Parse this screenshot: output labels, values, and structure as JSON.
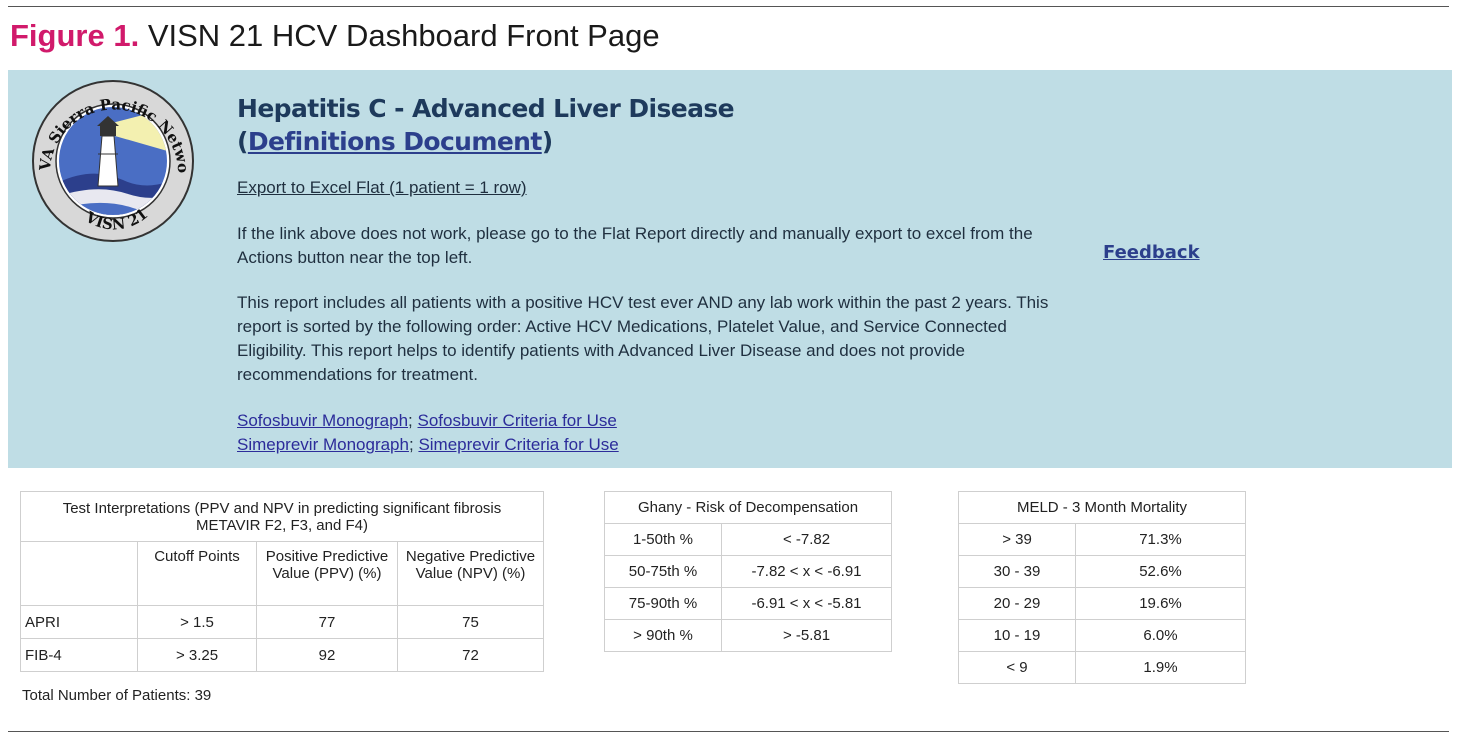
{
  "figure": {
    "number": "Figure 1.",
    "title": "VISN 21 HCV Dashboard Front Page"
  },
  "logo": {
    "arc_text": "VA Sierra Pacific Network",
    "bottom_text": "VISN 21"
  },
  "header": {
    "title_line1": "Hepatitis C - Advanced Liver Disease",
    "paren_open": "(",
    "definitions_link": "Definitions Document",
    "paren_close": ")"
  },
  "export_link": "Export to Excel Flat (1 patient = 1 row)",
  "note_link_fail": "If the link above does not work, please go to the Flat Report directly and manually export to excel from the Actions button near the top left.",
  "note_report": "This report includes all patients with a positive HCV test ever AND any lab work within the past 2 years. This report is sorted by the following order: Active HCV Medications, Platelet Value, and Service Connected Eligibility. This report helps to identify patients with Advanced Liver Disease and does not provide recommendations for treatment.",
  "feedback": "Feedback",
  "monograph_links": {
    "sofosbuvir_monograph": "Sofosbuvir Monograph",
    "sofosbuvir_criteria": "Sofosbuvir Criteria for Use",
    "simeprevir_monograph": "Simeprevir Monograph",
    "simeprevir_criteria": "Simeprevir Criteria for Use",
    "separator": ";"
  },
  "test_table": {
    "title": "Test Interpretations (PPV and NPV in predicting significant fibrosis METAVIR F2, F3, and F4)",
    "headers": [
      "",
      "Cutoff Points",
      "Positive Predictive Value (PPV) (%)",
      "Negative Predictive Value (NPV) (%)"
    ],
    "rows": [
      [
        "APRI",
        "> 1.5",
        "77",
        "75"
      ],
      [
        "FIB-4",
        "> 3.25",
        "92",
        "72"
      ]
    ]
  },
  "ghany_table": {
    "title": "Ghany - Risk of Decompensation",
    "rows": [
      [
        "1-50th %",
        "< -7.82"
      ],
      [
        "50-75th %",
        "-7.82 < x < -6.91"
      ],
      [
        "75-90th %",
        "-6.91 < x < -5.81"
      ],
      [
        "> 90th %",
        "> -5.81"
      ]
    ]
  },
  "meld_table": {
    "title": "MELD - 3 Month Mortality",
    "rows": [
      [
        "> 39",
        "71.3%"
      ],
      [
        "30 - 39",
        "52.6%"
      ],
      [
        "20 - 29",
        "19.6%"
      ],
      [
        "10 - 19",
        "6.0%"
      ],
      [
        "< 9",
        "1.9%"
      ]
    ]
  },
  "total_patients": "Total Number of Patients: 39",
  "colors": {
    "banner_bg": "#bfdde5",
    "figure_number": "#d11a6b",
    "heading": "#1e3a5c",
    "link": "#2c2c9a"
  }
}
